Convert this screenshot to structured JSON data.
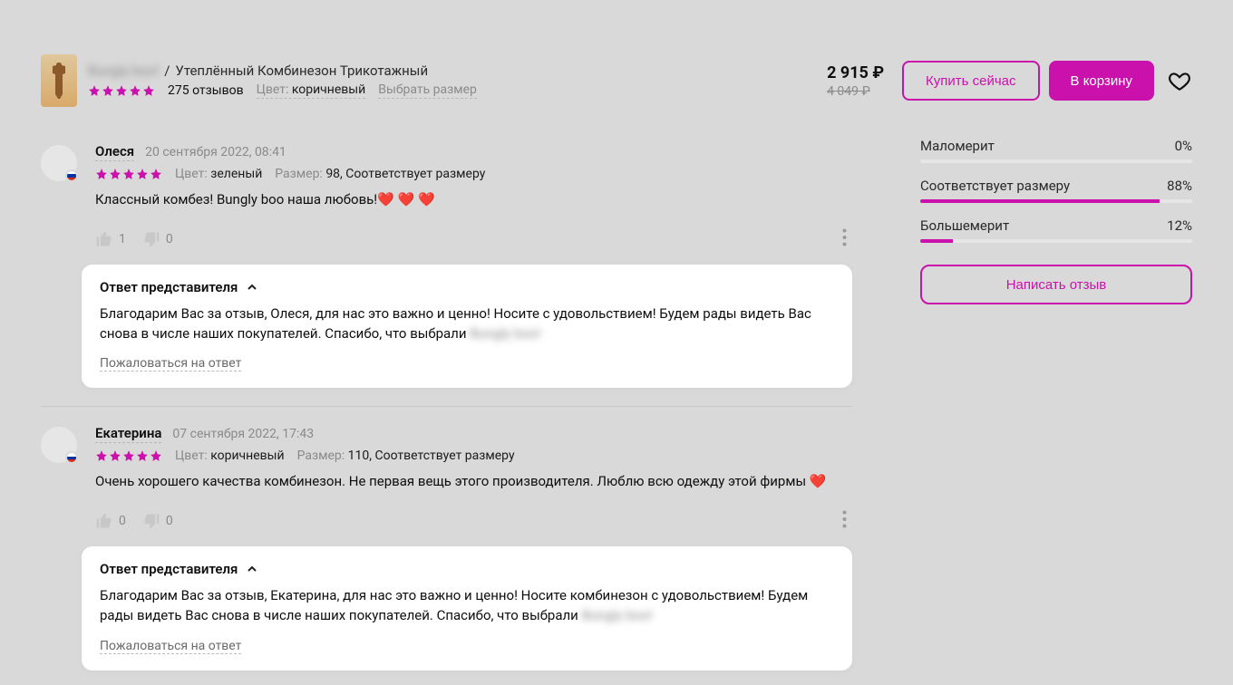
{
  "product": {
    "brand": "Bungly boo!",
    "title": "Утеплённый Комбинезон Трикотажный",
    "reviews_count_text": "275 отзывов",
    "color_label": "Цвет:",
    "color_value": "коричневый",
    "size_link": "Выбрать размер",
    "price_current": "2 915 ₽",
    "price_old": "4 049 ₽",
    "buy_now": "Купить сейчас",
    "to_cart": "В корзину"
  },
  "reviews": [
    {
      "name": "Олеся",
      "date": "20 сентября 2022, 08:41",
      "color_label": "Цвет:",
      "color_value": "зеленый",
      "size_label": "Размер:",
      "size_value": "98, Соответствует размеру",
      "text": "Классный комбез! Bungly boo наша любовь!❤️ ❤️ ❤️",
      "likes": "1",
      "dislikes": "0",
      "reply_label": "Ответ представителя",
      "reply_text_1": "Благодарим Вас за отзыв, Олеся, для нас это важно и ценно! Носите с удовольствием! Будем рады видеть Вас снова в числе наших покупателей. Спасибо, что выбрали ",
      "reply_brand": "Bungly boo!",
      "reply_complain": "Пожаловаться на ответ"
    },
    {
      "name": "Екатерина",
      "date": "07 сентября 2022, 17:43",
      "color_label": "Цвет:",
      "color_value": "коричневый",
      "size_label": "Размер:",
      "size_value": "110, Соответствует размеру",
      "text": "Очень хорошего качества комбинезон. Не первая вещь этого производителя. Люблю всю одежду этой фирмы ❤️",
      "likes": "0",
      "dislikes": "0",
      "reply_label": "Ответ представителя",
      "reply_text_1": "Благодарим Вас за отзыв, Екатерина, для нас это важно и ценно! Носите комбинезон с удовольствием! Будем рады видеть Вас снова в числе наших покупателей. Спасибо, что выбрали ",
      "reply_brand": "Bungly boo!",
      "reply_complain": "Пожаловаться на ответ"
    }
  ],
  "fit": {
    "small_label": "Маломерит",
    "small_pct": "0%",
    "small_w": "0%",
    "true_label": "Соответствует размеру",
    "true_pct": "88%",
    "true_w": "88%",
    "big_label": "Большемерит",
    "big_pct": "12%",
    "big_w": "12%"
  },
  "write_review": "Написать отзыв"
}
